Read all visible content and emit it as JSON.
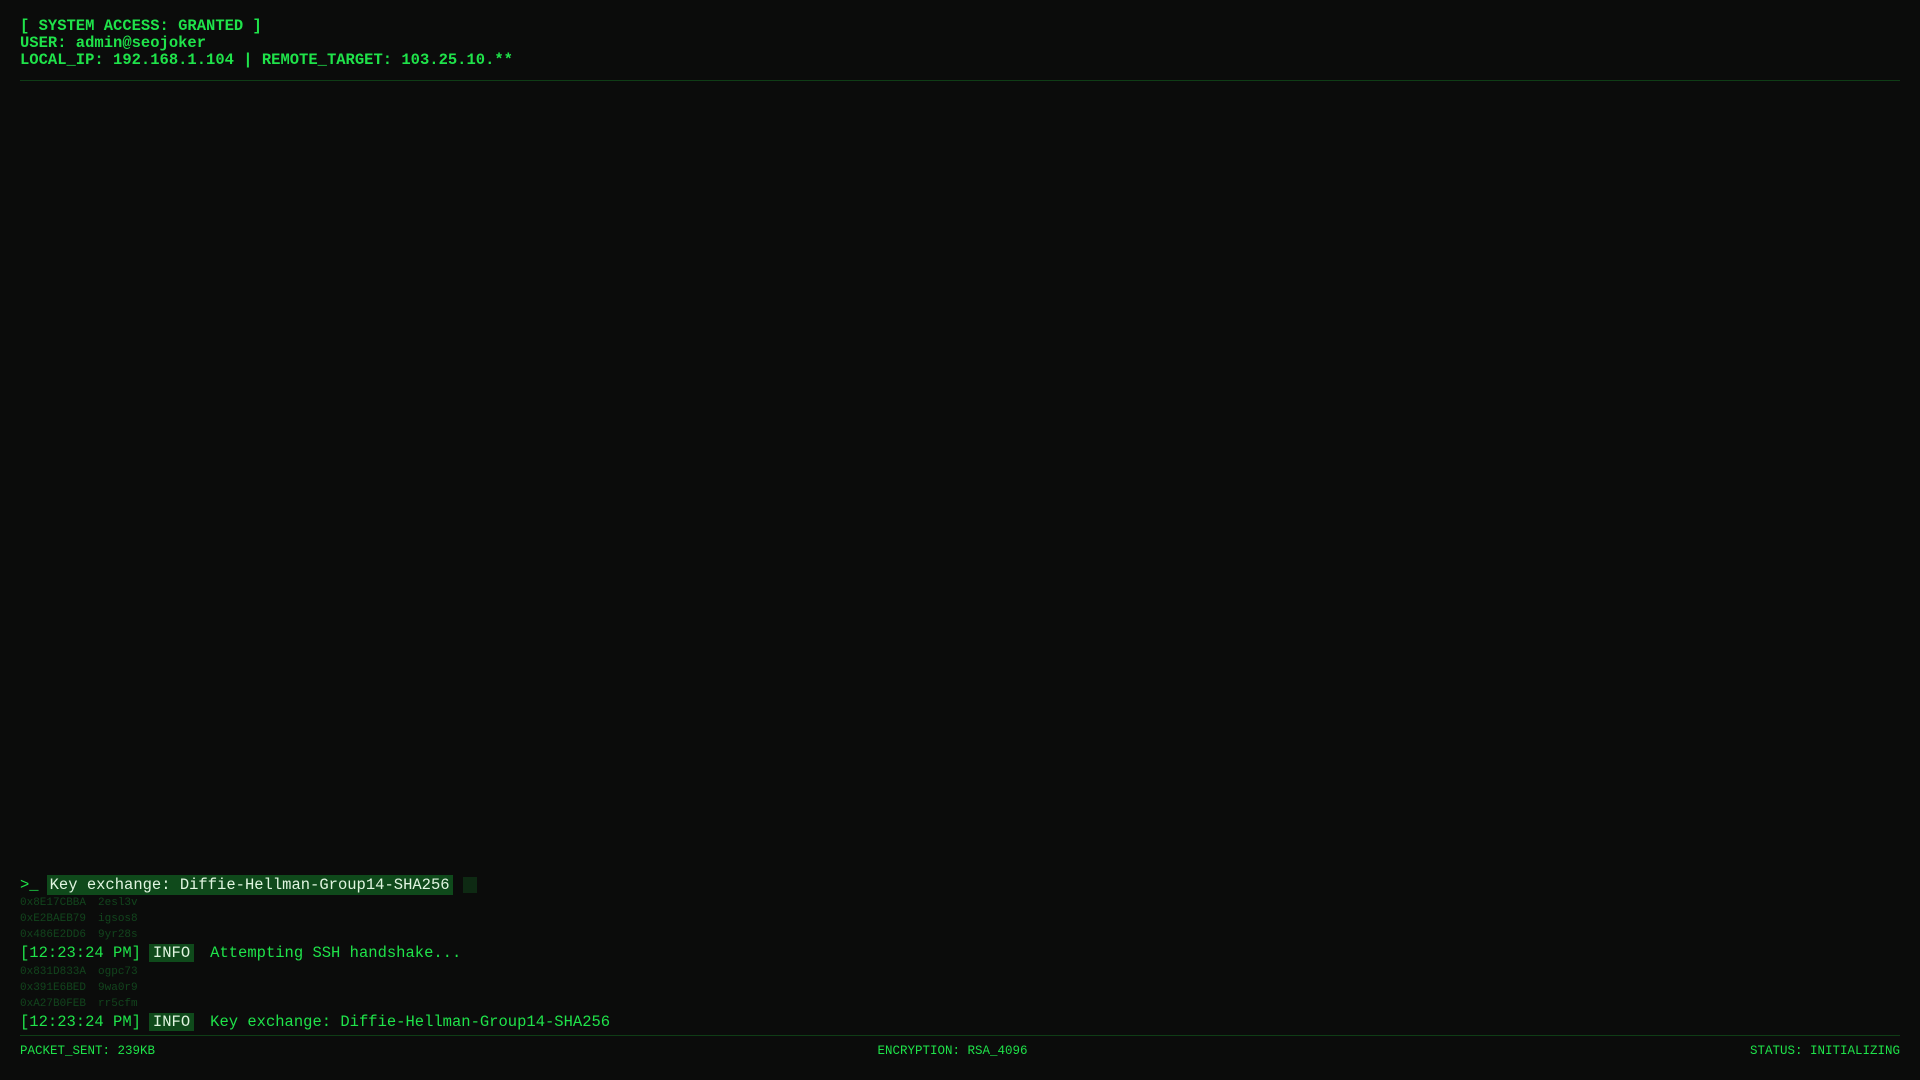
{
  "header": {
    "line1": "[ SYSTEM ACCESS: GRANTED ]",
    "line2": "USER: admin@seojoker",
    "line3": "LOCAL_IP: 192.168.1.104 | REMOTE_TARGET: 103.25.10.**"
  },
  "prompt": {
    "symbol": ">_",
    "current": "Key exchange: Diffie-Hellman-Group14-SHA256"
  },
  "hex_block_1": [
    [
      "0x8E17CBBA",
      "2esl3v"
    ],
    [
      "0xE2BAEB79",
      "igsos8"
    ],
    [
      "0x486E2DD6",
      "9yr28s"
    ]
  ],
  "entry_1": {
    "time": "[12:23:24 PM]",
    "level": "INFO",
    "message": "Attempting SSH handshake..."
  },
  "hex_block_2": [
    [
      "0x831D833A",
      "ogpc73"
    ],
    [
      "0x391E6BED",
      "9wa0r9"
    ],
    [
      "0xA27B0FEB",
      "rr5cfm"
    ]
  ],
  "entry_2": {
    "time": "[12:23:24 PM]",
    "level": "INFO",
    "message": "Key exchange: Diffie-Hellman-Group14-SHA256"
  },
  "footer": {
    "packets": "PACKET_SENT: 239KB",
    "encryption": "ENCRYPTION: RSA_4096",
    "status": "STATUS: INITIALIZING"
  }
}
